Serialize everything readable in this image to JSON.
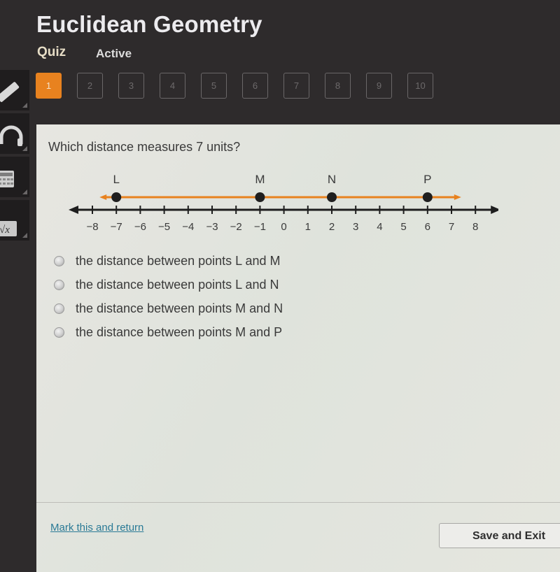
{
  "header": {
    "title": "Euclidean Geometry",
    "section": "Quiz",
    "status": "Active"
  },
  "question_nav": {
    "current": 1,
    "items": [
      "1",
      "2",
      "3",
      "4",
      "5",
      "6",
      "7",
      "8",
      "9",
      "10"
    ]
  },
  "sidebar": {
    "tools": [
      {
        "name": "pencil",
        "icon": "pencil-icon"
      },
      {
        "name": "audio",
        "icon": "headphones-icon"
      },
      {
        "name": "calculator",
        "icon": "calculator-icon"
      },
      {
        "name": "formulas",
        "icon": "square-root-icon",
        "glyph": "√x"
      }
    ]
  },
  "question": {
    "text": "Which distance measures 7 units?",
    "number_line": {
      "min": -8,
      "max": 8,
      "tick_labels": [
        "−8",
        "−7",
        "−6",
        "−5",
        "−4",
        "−3",
        "−2",
        "−1",
        "0",
        "1",
        "2",
        "3",
        "4",
        "5",
        "6",
        "7",
        "8"
      ],
      "points": [
        {
          "label": "L",
          "value": -7
        },
        {
          "label": "M",
          "value": -1
        },
        {
          "label": "N",
          "value": 2
        },
        {
          "label": "P",
          "value": 6
        }
      ],
      "highlight_color": "#e8821f",
      "axis_color": "#1e1e1e"
    },
    "options": [
      {
        "text": "the distance between points L and M",
        "selected": false
      },
      {
        "text": "the distance between points L and N",
        "selected": false
      },
      {
        "text": "the distance between points M and N",
        "selected": false
      },
      {
        "text": "the distance between points M and P",
        "selected": false
      }
    ]
  },
  "footer": {
    "mark_link": "Mark this and return",
    "save_button": "Save and Exit"
  }
}
